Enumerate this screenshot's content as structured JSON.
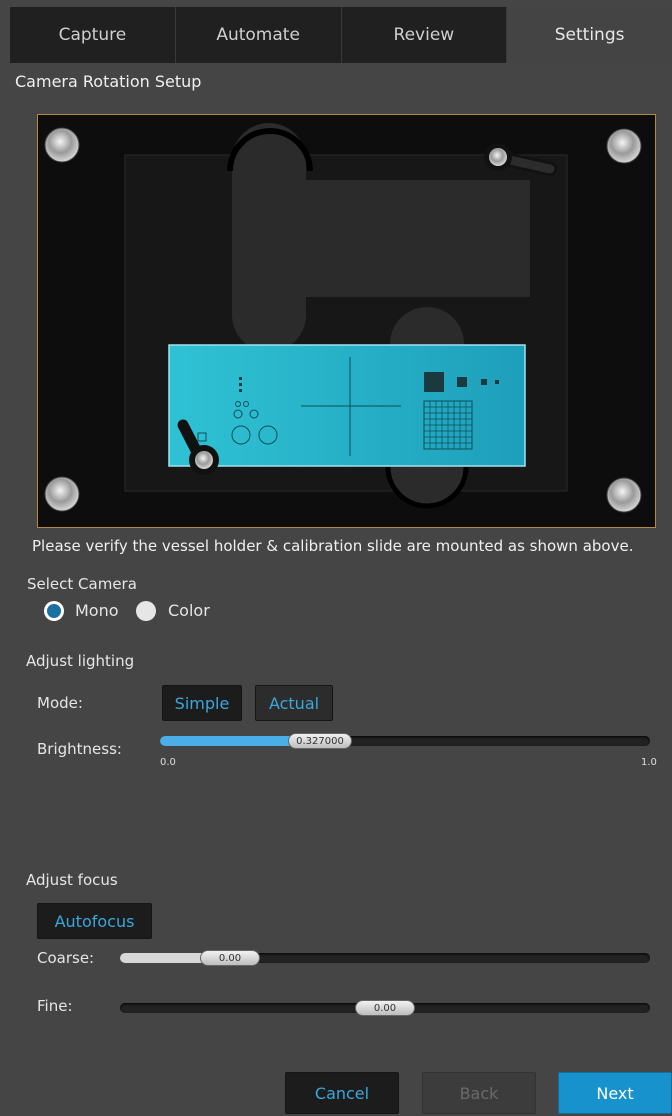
{
  "tabs": [
    {
      "label": "Capture"
    },
    {
      "label": "Automate"
    },
    {
      "label": "Review"
    },
    {
      "label": "Settings"
    }
  ],
  "active_tab": "Settings",
  "section_title": "Camera Rotation Setup",
  "verify_text": "Please verify the vessel holder & calibration slide are mounted as shown above.",
  "camera": {
    "heading": "Select Camera",
    "options": [
      {
        "label": "Mono",
        "selected": true
      },
      {
        "label": "Color",
        "selected": false
      }
    ]
  },
  "lighting": {
    "heading": "Adjust lighting",
    "mode_label": "Mode:",
    "mode_options": [
      "Simple",
      "Actual"
    ],
    "brightness_label": "Brightness:",
    "brightness_value": "0.327000",
    "brightness_fraction": 0.327,
    "min_label": "0.0",
    "max_label": "1.0"
  },
  "focus": {
    "heading": "Adjust focus",
    "autofocus_label": "Autofocus",
    "coarse_label": "Coarse:",
    "coarse_value": "0.00",
    "fine_label": "Fine:",
    "fine_value": "0.00"
  },
  "footer": {
    "cancel_label": "Cancel",
    "back_label": "Back",
    "next_label": "Next"
  },
  "colors": {
    "accent": "#3ba7dd",
    "next_button": "#1792cc",
    "frame_border": "#b58a3d",
    "slide": "#2bb3c8"
  }
}
